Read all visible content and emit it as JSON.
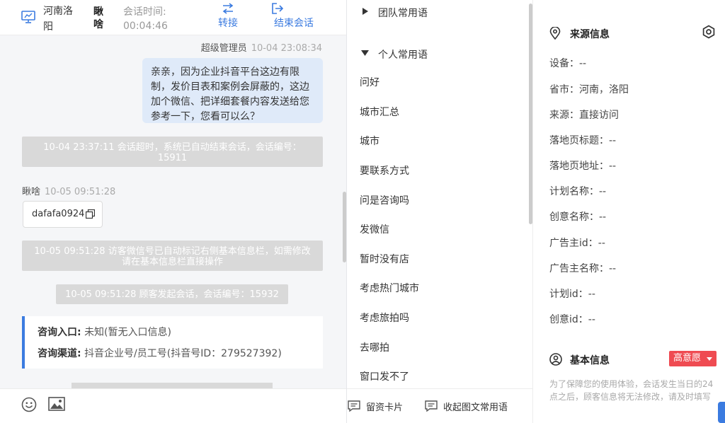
{
  "header": {
    "region": "河南洛阳",
    "user": "瞅啥",
    "session_time_label": "会话时间:",
    "session_time": "00:04:46",
    "transfer_label": "转接",
    "end_label": "结束会话"
  },
  "chat": {
    "admin_sender": "超级管理员",
    "admin_time": "10-04 23:08:34",
    "admin_message": "亲亲，因为企业抖音平台这边有限制，发价目表和案例会屏蔽的，这边加个微信、把详细套餐内容发送给您参考一下，您看可以么？",
    "sys_timeout": "10-04 23:37:11 会话超时，系统已自动结束会话，会话编号：15911",
    "visitor_sender": "瞅啥",
    "visitor_time": "10-05 09:51:28",
    "visitor_card": "dafafa0924",
    "sys_wechat": "10-05 09:51:28 访客微信号已自动标记右侧基本信息栏，如需修改请在基本信息栏直接操作",
    "sys_start": "10-05 09:51:28 顾客发起会话，会话编号：15932",
    "entry_label": "咨询入口:",
    "entry_value": "未知(暂无入口信息)",
    "channel_label": "咨询渠道:",
    "channel_value": "抖音企业号/员工号(抖音号ID：279527392)"
  },
  "footer": {
    "icons": [
      "smile-icon",
      "image-icon"
    ],
    "leave_card_label": "留资卡片",
    "collapse_label": "收起图文常用语"
  },
  "phrases": {
    "team_group": "团队常用语",
    "personal_group": "个人常用语",
    "items": [
      "问好",
      "城市汇总",
      "城市",
      "要联系方式",
      "问是咨询吗",
      "发微信",
      "暂时没有店",
      "考虑热门城市",
      "考虑旅拍吗",
      "去哪拍",
      "窗口发不了"
    ]
  },
  "info": {
    "source_title": "来源信息",
    "rows": [
      "设备：--",
      "省市：河南，洛阳",
      "来源：直接访问",
      "落地页标题：--",
      "落地页地址：--",
      "计划名称：--",
      "创意名称：--",
      "广告主id：--",
      "广告主名称：--",
      "计划id：--",
      "创意id：--"
    ],
    "basic_title": "基本信息",
    "intent_badge": "高意愿",
    "note": "为了保障您的使用体验，会话发生当日的24点之后，顾客信息将无法修改，请及时填写"
  },
  "colors": {
    "accent": "#3b7be0",
    "bubble": "#dfeaf9",
    "system_note": "#d9d9d9",
    "badge": "#ef4b52"
  }
}
